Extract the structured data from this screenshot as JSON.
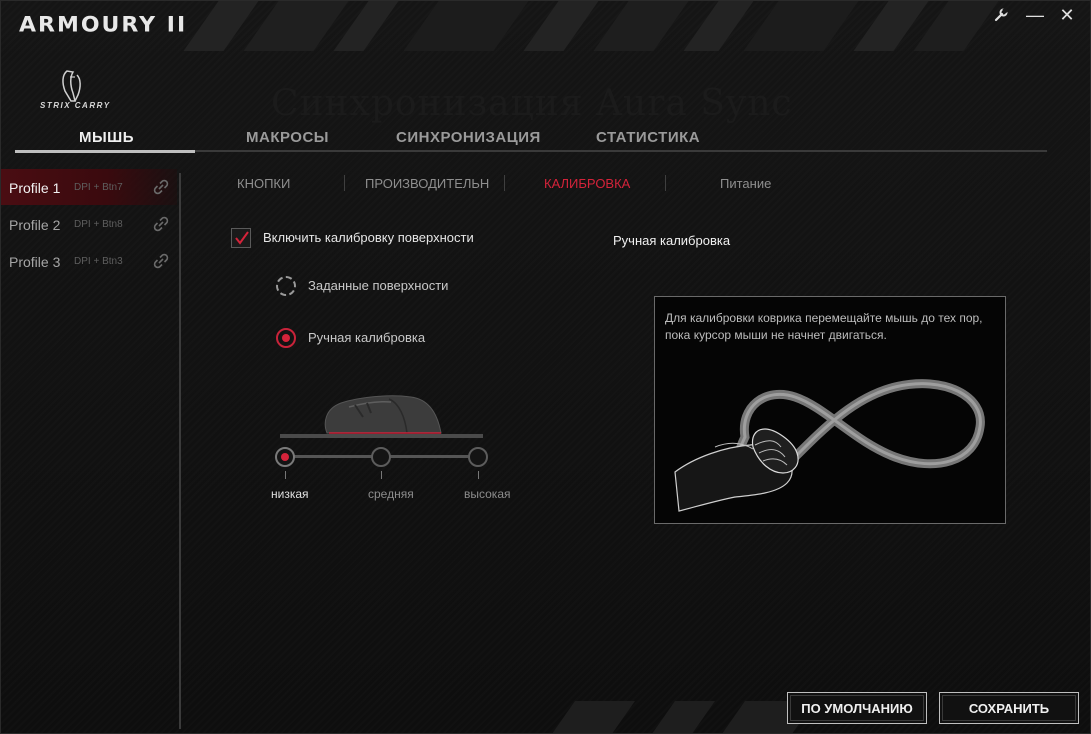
{
  "app": {
    "title": "ARMOURY II",
    "device": "STRIX CARRY",
    "background_title": "Синхронизация Aura Sync"
  },
  "titlebar": {
    "settings_icon": "wrench-icon",
    "minimize_label": "—",
    "close_label": "✕"
  },
  "main_tabs": [
    {
      "label": "МЫШЬ",
      "active": true
    },
    {
      "label": "МАКРОСЫ",
      "active": false
    },
    {
      "label": "СИНХРОНИЗАЦИЯ",
      "active": false
    },
    {
      "label": "СТАТИСТИКА",
      "active": false
    }
  ],
  "profiles": [
    {
      "name": "Profile 1",
      "shortcut": "DPI + Btn7",
      "active": true
    },
    {
      "name": "Profile 2",
      "shortcut": "DPI + Btn8",
      "active": false
    },
    {
      "name": "Profile 3",
      "shortcut": "DPI + Btn3",
      "active": false
    }
  ],
  "sub_tabs": [
    {
      "label": "КНОПКИ",
      "active": false
    },
    {
      "label": "ПРОИЗВОДИТЕЛЬН",
      "active": false
    },
    {
      "label": "КАЛИБРОВКА",
      "active": true
    },
    {
      "label": "Питание",
      "active": false
    }
  ],
  "calibration": {
    "enable_label": "Включить калибровку поверхности",
    "enabled": true,
    "options": [
      {
        "label": "Заданные поверхности",
        "selected": false
      },
      {
        "label": "Ручная калибровка",
        "selected": true
      }
    ],
    "levels": [
      "низкая",
      "средняя",
      "высокая"
    ],
    "selected_level": "низкая"
  },
  "manual_panel": {
    "title": "Ручная калибровка",
    "instruction": "Для калибровки коврика перемещайте мышь до тех пор, пока курсор мыши не начнет двигаться."
  },
  "buttons": {
    "default_label": "ПО УМОЛЧАНИЮ",
    "save_label": "СОХРАНИТЬ"
  },
  "colors": {
    "accent": "#d4233a",
    "background": "#111111",
    "text": "#cfcfcf"
  }
}
